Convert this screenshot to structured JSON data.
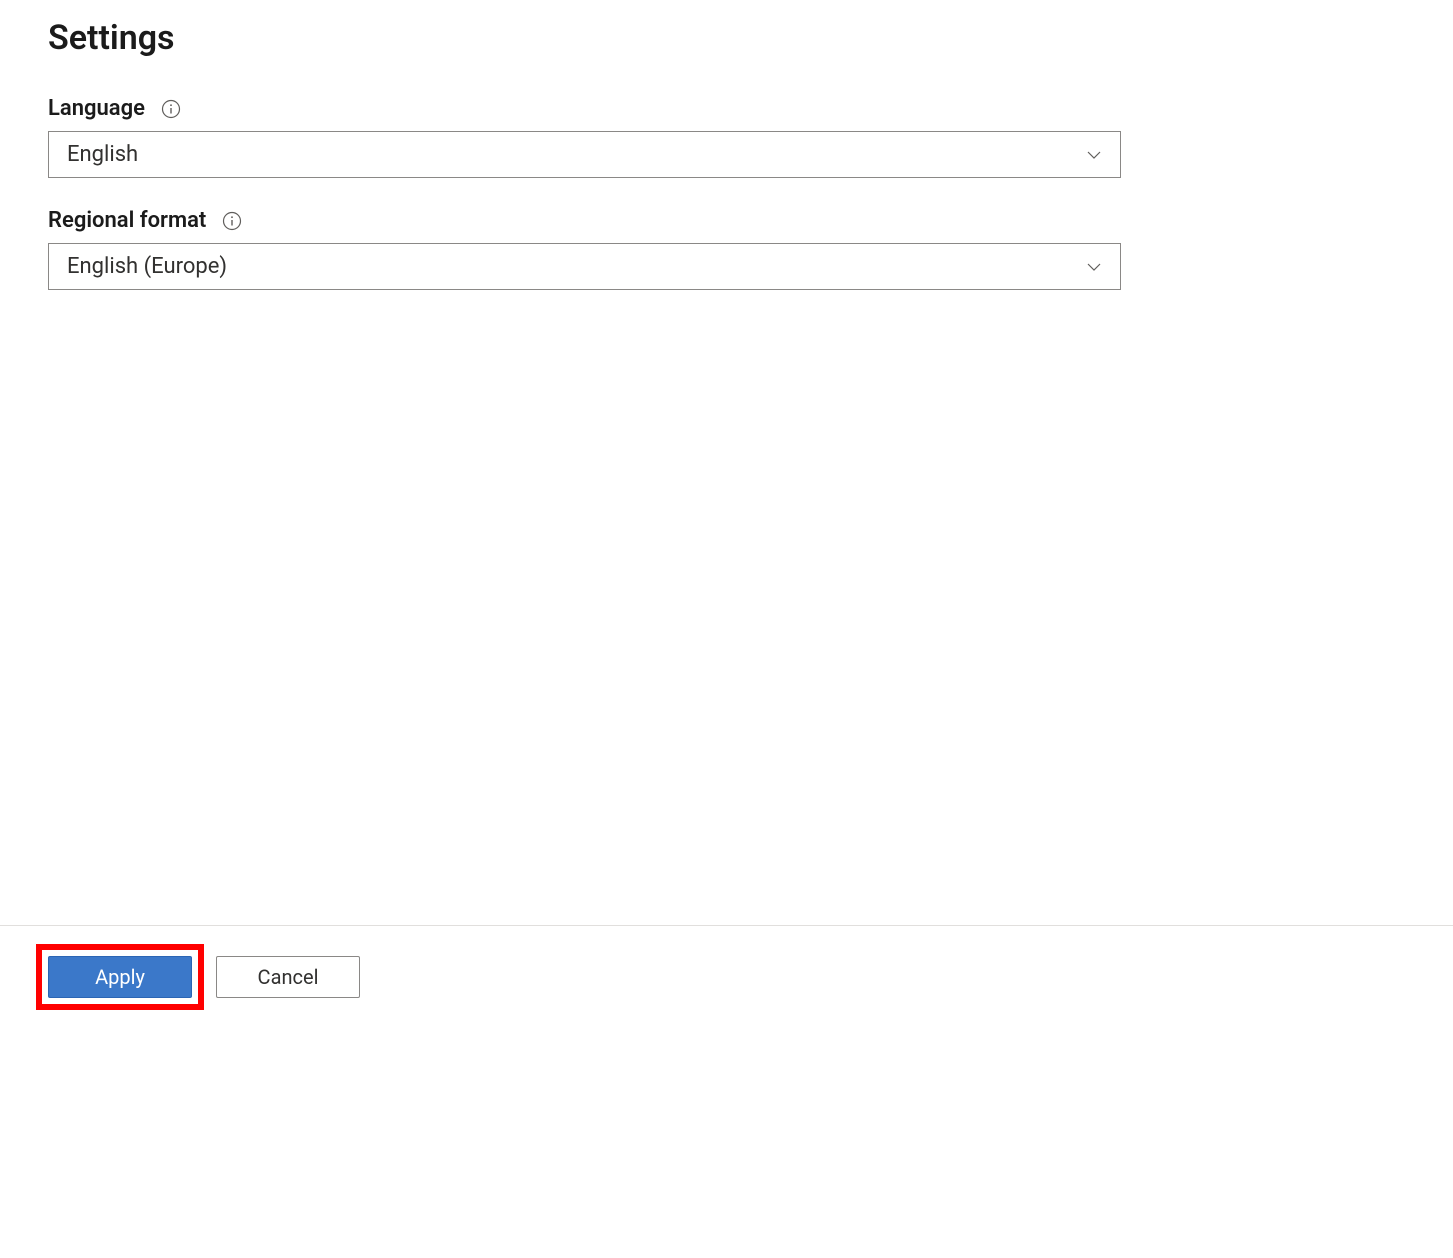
{
  "header": {
    "title": "Settings"
  },
  "fields": {
    "language": {
      "label": "Language",
      "value": "English"
    },
    "regional_format": {
      "label": "Regional format",
      "value": "English (Europe)"
    }
  },
  "footer": {
    "apply_label": "Apply",
    "cancel_label": "Cancel"
  }
}
